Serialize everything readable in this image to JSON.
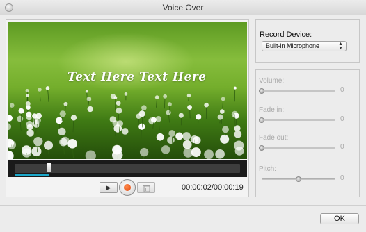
{
  "window": {
    "title": "Voice Over"
  },
  "preview": {
    "overlay_text": "Text Here  Text Here"
  },
  "timeline": {
    "progress": 0.15
  },
  "controls": {
    "play_icon": "▶",
    "record_icon": "record-icon",
    "delete_icon": "trash-icon",
    "time": "00:00:02/00:00:19"
  },
  "record_device": {
    "label": "Record Device:",
    "selected": "Built-in Microphone"
  },
  "sliders": [
    {
      "label": "Volume:",
      "value": "0",
      "level": 0
    },
    {
      "label": "Fade in:",
      "value": "0",
      "level": 0
    },
    {
      "label": "Fade out:",
      "value": "0",
      "level": 0
    },
    {
      "label": "Pitch:",
      "value": "0",
      "level": 0.5
    }
  ],
  "footer": {
    "ok_label": "OK"
  },
  "colors": {
    "record_orange": "#e0460f",
    "progress_blue": "#1ba7c9",
    "disabled_text": "#a9a9a9"
  }
}
